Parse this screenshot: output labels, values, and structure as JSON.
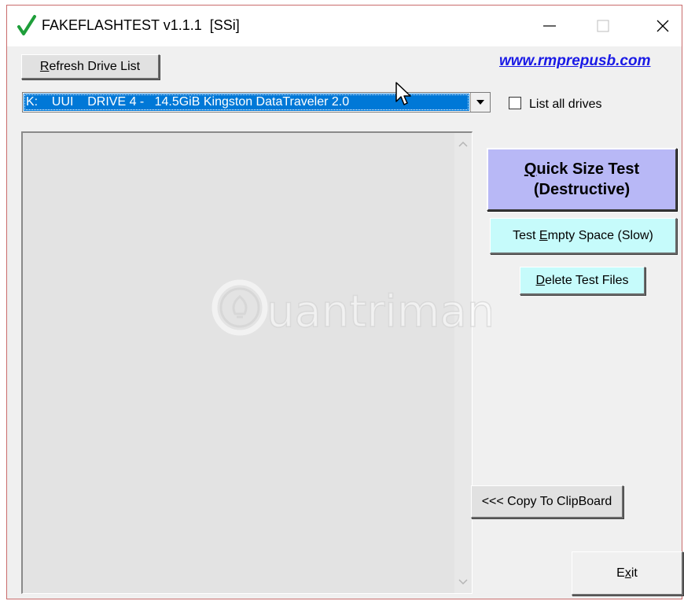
{
  "window": {
    "title": "FAKEFLASHTEST v1.1.1  [SSi]",
    "icon": "checkmark-icon"
  },
  "toolbar": {
    "refresh_prefix": "R",
    "refresh_rest": "efresh Drive List",
    "website": "www.rmprepusb.com"
  },
  "drive_select": {
    "value": "K:    UUI    DRIVE 4 -   14.5GiB Kingston DataTraveler 2.0"
  },
  "list_all": {
    "label": "List all drives",
    "checked": false
  },
  "watermark": {
    "text": "uantrimang"
  },
  "buttons": {
    "quick_prefix": "Q",
    "quick_rest": "uick Size Test",
    "quick_line2": "(Destructive)",
    "test_empty_a": "Test ",
    "test_empty_u": "E",
    "test_empty_b": "mpty Space (Slow)",
    "delete_u": "D",
    "delete_rest": "elete Test Files",
    "copy": "<<< Copy To ClipBoard",
    "exit_a": "E",
    "exit_u": "x",
    "exit_b": "it"
  },
  "colors": {
    "quick_test_bg": "#b8b8f6",
    "cyan_button_bg": "#c6fbfb",
    "selection": "#0078d7",
    "link": "#1a1ae6",
    "check_icon": "#1e9e3a"
  }
}
